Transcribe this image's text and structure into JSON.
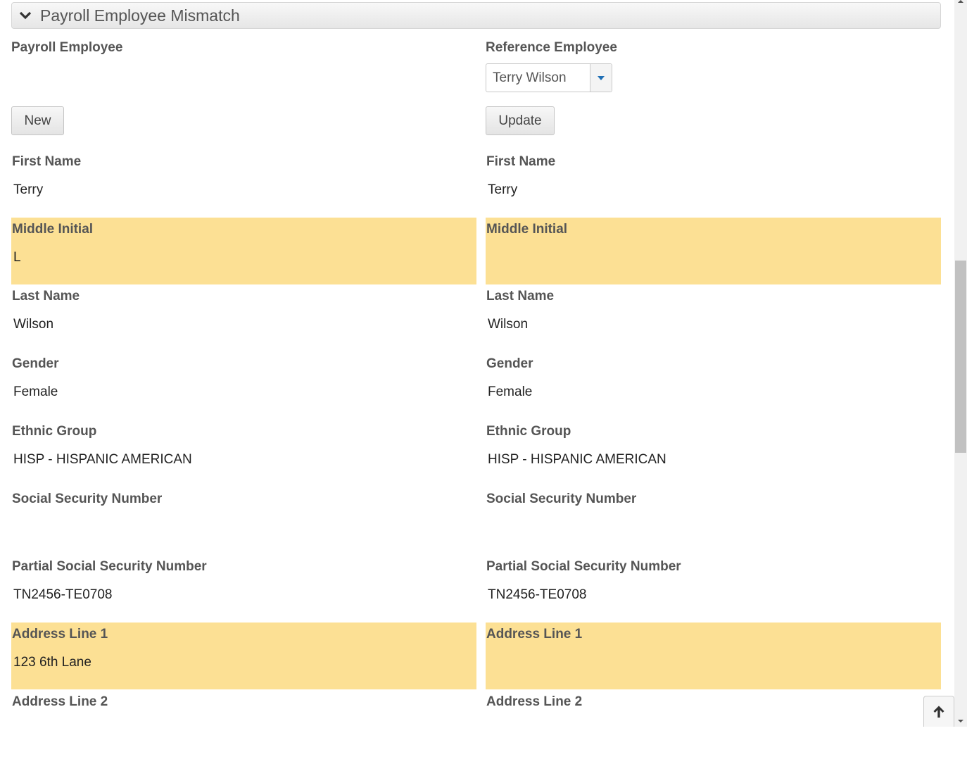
{
  "panel": {
    "title": "Payroll Employee Mismatch",
    "collapse_icon": "chevron-down-icon"
  },
  "left": {
    "heading": "Payroll Employee",
    "button_label": "New",
    "fields": [
      {
        "label": "First Name",
        "value": "Terry",
        "mismatch": false
      },
      {
        "label": "Middle Initial",
        "value": "L",
        "mismatch": true
      },
      {
        "label": "Last Name",
        "value": "Wilson",
        "mismatch": false
      },
      {
        "label": "Gender",
        "value": "Female",
        "mismatch": false
      },
      {
        "label": "Ethnic Group",
        "value": "HISP - HISPANIC AMERICAN",
        "mismatch": false
      },
      {
        "label": "Social Security Number",
        "value": "",
        "mismatch": false
      },
      {
        "label": "Partial Social Security Number",
        "value": "TN2456-TE0708",
        "mismatch": false
      },
      {
        "label": "Address Line 1",
        "value": "123 6th Lane",
        "mismatch": true
      },
      {
        "label": "Address Line 2",
        "value": "",
        "mismatch": false
      }
    ]
  },
  "right": {
    "heading": "Reference Employee",
    "select_value": "Terry Wilson",
    "button_label": "Update",
    "fields": [
      {
        "label": "First Name",
        "value": "Terry",
        "mismatch": false
      },
      {
        "label": "Middle Initial",
        "value": "",
        "mismatch": true
      },
      {
        "label": "Last Name",
        "value": "Wilson",
        "mismatch": false
      },
      {
        "label": "Gender",
        "value": "Female",
        "mismatch": false
      },
      {
        "label": "Ethnic Group",
        "value": "HISP - HISPANIC AMERICAN",
        "mismatch": false
      },
      {
        "label": "Social Security Number",
        "value": "",
        "mismatch": false
      },
      {
        "label": "Partial Social Security Number",
        "value": "TN2456-TE0708",
        "mismatch": false
      },
      {
        "label": "Address Line 1",
        "value": "",
        "mismatch": true
      },
      {
        "label": "Address Line 2",
        "value": "",
        "mismatch": false
      }
    ]
  },
  "colors": {
    "mismatch_highlight": "#fce094",
    "select_arrow": "#1f6fb5"
  },
  "scroll_top_icon": "arrow-up-icon"
}
